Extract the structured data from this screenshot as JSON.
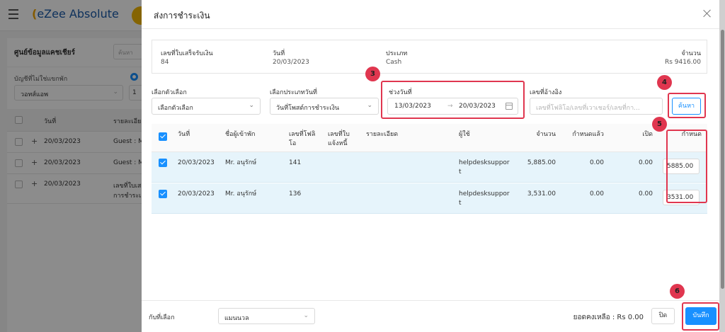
{
  "background": {
    "app_name": "eZee Absolute",
    "panel_title": "ศูนย์ข้อมูลแคชเชียร์",
    "search_placeholder": "ค้นหา",
    "filter_label": "บัญชีที่ไม่ใช่แขกพัก",
    "filter_select": "วอทส์แอพ",
    "filter_select2": "1",
    "columns": [
      "วันที่",
      "รายละเอีย"
    ],
    "rows": [
      {
        "date": "20/03/2023",
        "detail": "Guest : M"
      },
      {
        "date": "20/03/2023",
        "detail": "Guest : M"
      },
      {
        "date": "20/03/2023",
        "detail": "เลขที่ใบเส",
        "detail2": "การชำระเ"
      }
    ]
  },
  "drawer": {
    "title": "ส่งการชำระเงิน",
    "summary": {
      "receipt_no_label": "เลขที่ใบเสร็จรับเงิน",
      "receipt_no": "84",
      "date_label": "วันที่",
      "date": "20/03/2023",
      "type_label": "ประเภท",
      "type": "Cash",
      "amount_label": "จำนวน",
      "amount": "Rs 9416.00"
    },
    "filters": {
      "option_label": "เลือกตัวเลือก",
      "option_value": "เลือกตัวเลือก",
      "date_type_label": "เลือกประเภทวันที่",
      "date_type_value": "วันที่โพสต์การชำระเงิน",
      "date_range_label": "ช่วงวันที่",
      "date_from": "13/03/2023",
      "date_to": "20/03/2023",
      "date_arrow": "→",
      "reference_label": "เลขที่อ้างอิง",
      "reference_placeholder": "เลขที่โฟลิโอ/เลขที่เวาเชอร์/เลขที่กา...",
      "search_button": "ค้นหา"
    },
    "table": {
      "headers": {
        "date": "วันที่",
        "guest": "ชื่อผู้เข้าพัก",
        "folio_1": "เลขที่โฟลิ",
        "folio_2": "โอ",
        "invoice_1": "เลขที่ใบ",
        "invoice_2": "แจ้งหนี้",
        "details": "รายละเอียด",
        "user": "ผู้ใช้",
        "amount": "จำนวน",
        "allocated": "กำหนดแล้ว",
        "open": "เปิด",
        "allocate": "กำหนด"
      },
      "rows": [
        {
          "date": "20/03/2023",
          "guest": "Mr. อนุรักษ์",
          "folio": "141",
          "user_1": "helpdesksuppor",
          "user_2": "t",
          "amount": "5,885.00",
          "allocated": "0.00",
          "open": "0.00",
          "allocate": "5885.00"
        },
        {
          "date": "20/03/2023",
          "guest": "Mr. อนุรักษ์",
          "folio": "136",
          "user_1": "helpdesksuppor",
          "user_2": "t",
          "amount": "3,531.00",
          "allocated": "0.00",
          "open": "0.00",
          "allocate": "3531.00"
        }
      ]
    },
    "footer": {
      "selection_label": "กับที่เลือก",
      "selection_value": "แมนนวล",
      "balance": "ยอดคงเหลือ : Rs 0.00",
      "close_button": "ปิด",
      "save_button": "บันทึก"
    }
  },
  "annotations": [
    "3",
    "4",
    "5",
    "6"
  ],
  "colors": {
    "accent": "#1890ff",
    "highlight": "#e0364f",
    "row_selected": "#e6f4fb"
  }
}
